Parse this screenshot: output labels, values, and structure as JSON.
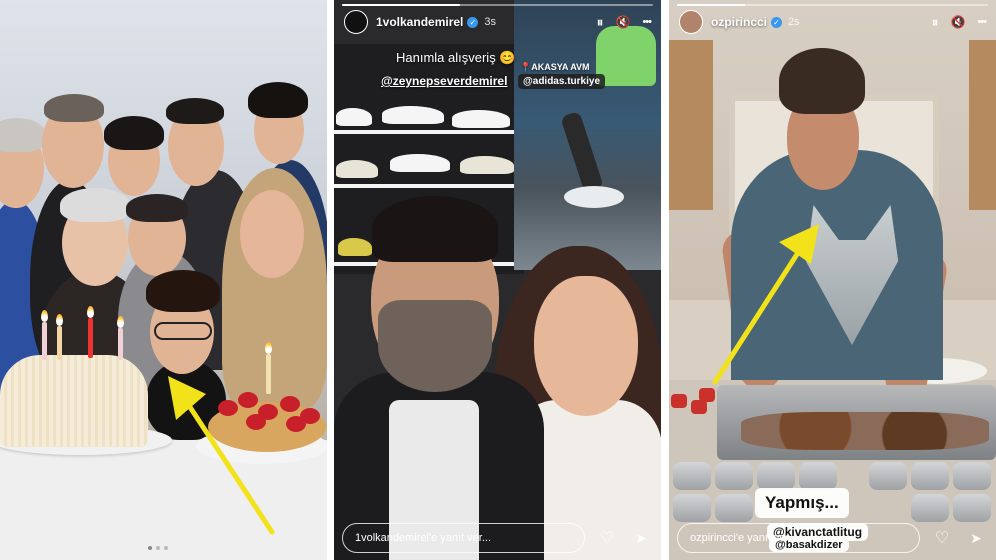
{
  "colors": {
    "arrow": "#f2e21a",
    "verified": "#3897f0",
    "sticker_bg": "#ffffff"
  },
  "panel2": {
    "header": {
      "username": "1volkandemirel",
      "time": "3s"
    },
    "text_line": "Hanımla alışveriş 😊",
    "mention_1": "@zeynepseverdemirel",
    "location": "📍AKASYA AVM",
    "mention_2": "@adidas.turkiye",
    "reply_placeholder": "1volkandemirel'e yanıt ver..."
  },
  "panel3": {
    "header": {
      "username": "ozpirincci",
      "time": "2s"
    },
    "caption": "Yapmış...",
    "mention_1": "@kivanctatlitug",
    "mention_2": "@basakdizer",
    "reply_placeholder": "ozpirincci'e yanıt ver..."
  },
  "icons": {
    "pause": "⏸",
    "mute": "🔇",
    "more": "•••",
    "heart": "♡",
    "send": "➤"
  }
}
